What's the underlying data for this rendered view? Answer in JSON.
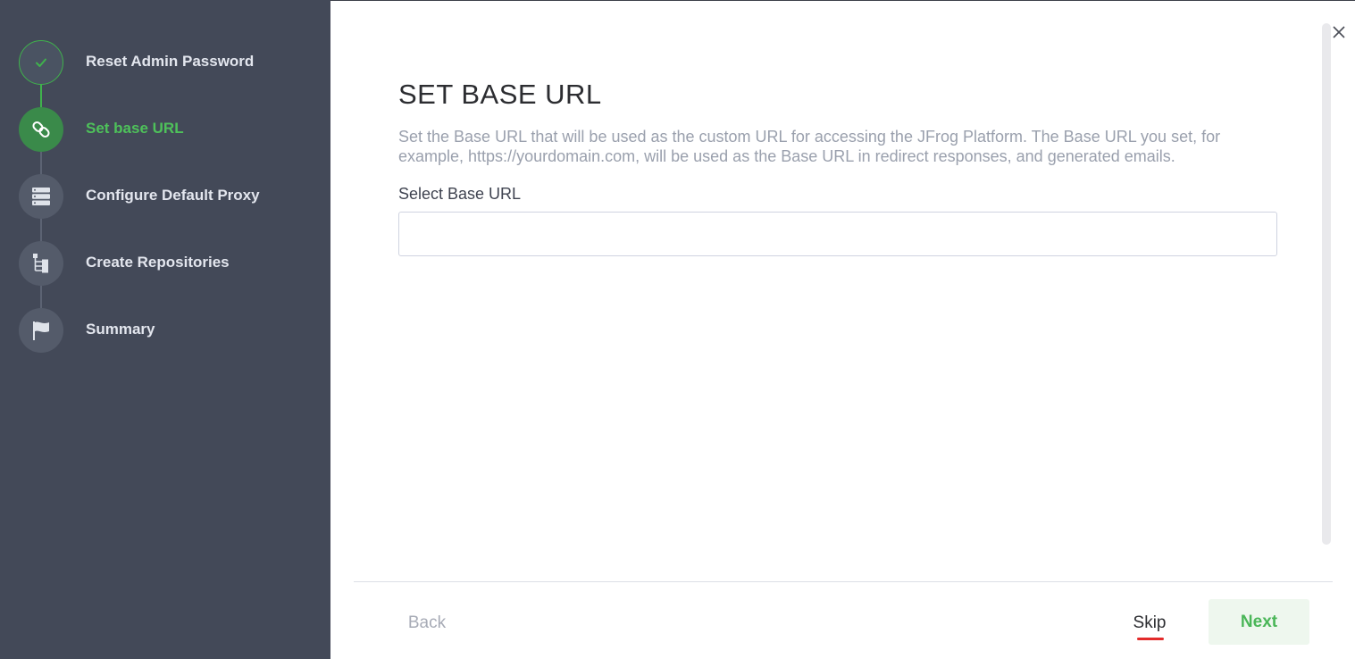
{
  "sidebar": {
    "steps": [
      {
        "label": "Reset Admin Password",
        "state": "done",
        "icon": "check-icon"
      },
      {
        "label": "Set base URL",
        "state": "active",
        "icon": "link-icon"
      },
      {
        "label": "Configure Default Proxy",
        "state": "pending",
        "icon": "server-icon"
      },
      {
        "label": "Create Repositories",
        "state": "pending",
        "icon": "repository-tree-icon"
      },
      {
        "label": "Summary",
        "state": "pending",
        "icon": "flag-icon"
      }
    ]
  },
  "main": {
    "title": "SET BASE URL",
    "description": "Set the Base URL that will be used as the custom URL for accessing the JFrog Platform. The Base URL you set, for example, https://yourdomain.com, will be used as the Base URL in redirect responses, and generated emails.",
    "field_label": "Select Base URL",
    "input_value": "",
    "input_placeholder": ""
  },
  "footer": {
    "back_label": "Back",
    "skip_label": "Skip",
    "next_label": "Next"
  },
  "colors": {
    "sidebar_bg": "#434958",
    "accent_green": "#4ec15a",
    "skip_underline": "#e32b2b"
  }
}
